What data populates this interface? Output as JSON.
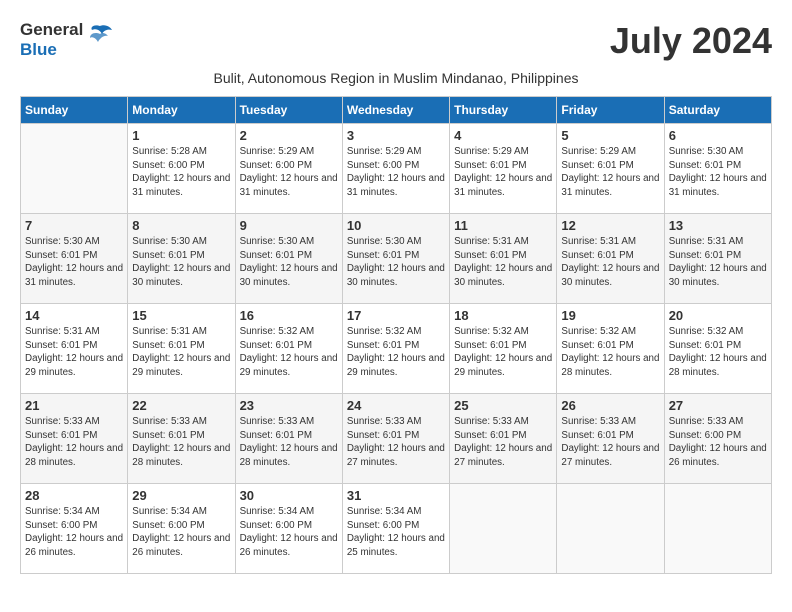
{
  "header": {
    "logo_general": "General",
    "logo_blue": "Blue",
    "month_title": "July 2024",
    "subtitle": "Bulit, Autonomous Region in Muslim Mindanao, Philippines"
  },
  "days_of_week": [
    "Sunday",
    "Monday",
    "Tuesday",
    "Wednesday",
    "Thursday",
    "Friday",
    "Saturday"
  ],
  "weeks": [
    {
      "id": "week1",
      "days": [
        {
          "date": "",
          "sunrise": "",
          "sunset": "",
          "daylight": ""
        },
        {
          "date": "1",
          "sunrise": "Sunrise: 5:28 AM",
          "sunset": "Sunset: 6:00 PM",
          "daylight": "Daylight: 12 hours and 31 minutes."
        },
        {
          "date": "2",
          "sunrise": "Sunrise: 5:29 AM",
          "sunset": "Sunset: 6:00 PM",
          "daylight": "Daylight: 12 hours and 31 minutes."
        },
        {
          "date": "3",
          "sunrise": "Sunrise: 5:29 AM",
          "sunset": "Sunset: 6:00 PM",
          "daylight": "Daylight: 12 hours and 31 minutes."
        },
        {
          "date": "4",
          "sunrise": "Sunrise: 5:29 AM",
          "sunset": "Sunset: 6:01 PM",
          "daylight": "Daylight: 12 hours and 31 minutes."
        },
        {
          "date": "5",
          "sunrise": "Sunrise: 5:29 AM",
          "sunset": "Sunset: 6:01 PM",
          "daylight": "Daylight: 12 hours and 31 minutes."
        },
        {
          "date": "6",
          "sunrise": "Sunrise: 5:30 AM",
          "sunset": "Sunset: 6:01 PM",
          "daylight": "Daylight: 12 hours and 31 minutes."
        }
      ]
    },
    {
      "id": "week2",
      "days": [
        {
          "date": "7",
          "sunrise": "Sunrise: 5:30 AM",
          "sunset": "Sunset: 6:01 PM",
          "daylight": "Daylight: 12 hours and 31 minutes."
        },
        {
          "date": "8",
          "sunrise": "Sunrise: 5:30 AM",
          "sunset": "Sunset: 6:01 PM",
          "daylight": "Daylight: 12 hours and 30 minutes."
        },
        {
          "date": "9",
          "sunrise": "Sunrise: 5:30 AM",
          "sunset": "Sunset: 6:01 PM",
          "daylight": "Daylight: 12 hours and 30 minutes."
        },
        {
          "date": "10",
          "sunrise": "Sunrise: 5:30 AM",
          "sunset": "Sunset: 6:01 PM",
          "daylight": "Daylight: 12 hours and 30 minutes."
        },
        {
          "date": "11",
          "sunrise": "Sunrise: 5:31 AM",
          "sunset": "Sunset: 6:01 PM",
          "daylight": "Daylight: 12 hours and 30 minutes."
        },
        {
          "date": "12",
          "sunrise": "Sunrise: 5:31 AM",
          "sunset": "Sunset: 6:01 PM",
          "daylight": "Daylight: 12 hours and 30 minutes."
        },
        {
          "date": "13",
          "sunrise": "Sunrise: 5:31 AM",
          "sunset": "Sunset: 6:01 PM",
          "daylight": "Daylight: 12 hours and 30 minutes."
        }
      ]
    },
    {
      "id": "week3",
      "days": [
        {
          "date": "14",
          "sunrise": "Sunrise: 5:31 AM",
          "sunset": "Sunset: 6:01 PM",
          "daylight": "Daylight: 12 hours and 29 minutes."
        },
        {
          "date": "15",
          "sunrise": "Sunrise: 5:31 AM",
          "sunset": "Sunset: 6:01 PM",
          "daylight": "Daylight: 12 hours and 29 minutes."
        },
        {
          "date": "16",
          "sunrise": "Sunrise: 5:32 AM",
          "sunset": "Sunset: 6:01 PM",
          "daylight": "Daylight: 12 hours and 29 minutes."
        },
        {
          "date": "17",
          "sunrise": "Sunrise: 5:32 AM",
          "sunset": "Sunset: 6:01 PM",
          "daylight": "Daylight: 12 hours and 29 minutes."
        },
        {
          "date": "18",
          "sunrise": "Sunrise: 5:32 AM",
          "sunset": "Sunset: 6:01 PM",
          "daylight": "Daylight: 12 hours and 29 minutes."
        },
        {
          "date": "19",
          "sunrise": "Sunrise: 5:32 AM",
          "sunset": "Sunset: 6:01 PM",
          "daylight": "Daylight: 12 hours and 28 minutes."
        },
        {
          "date": "20",
          "sunrise": "Sunrise: 5:32 AM",
          "sunset": "Sunset: 6:01 PM",
          "daylight": "Daylight: 12 hours and 28 minutes."
        }
      ]
    },
    {
      "id": "week4",
      "days": [
        {
          "date": "21",
          "sunrise": "Sunrise: 5:33 AM",
          "sunset": "Sunset: 6:01 PM",
          "daylight": "Daylight: 12 hours and 28 minutes."
        },
        {
          "date": "22",
          "sunrise": "Sunrise: 5:33 AM",
          "sunset": "Sunset: 6:01 PM",
          "daylight": "Daylight: 12 hours and 28 minutes."
        },
        {
          "date": "23",
          "sunrise": "Sunrise: 5:33 AM",
          "sunset": "Sunset: 6:01 PM",
          "daylight": "Daylight: 12 hours and 28 minutes."
        },
        {
          "date": "24",
          "sunrise": "Sunrise: 5:33 AM",
          "sunset": "Sunset: 6:01 PM",
          "daylight": "Daylight: 12 hours and 27 minutes."
        },
        {
          "date": "25",
          "sunrise": "Sunrise: 5:33 AM",
          "sunset": "Sunset: 6:01 PM",
          "daylight": "Daylight: 12 hours and 27 minutes."
        },
        {
          "date": "26",
          "sunrise": "Sunrise: 5:33 AM",
          "sunset": "Sunset: 6:01 PM",
          "daylight": "Daylight: 12 hours and 27 minutes."
        },
        {
          "date": "27",
          "sunrise": "Sunrise: 5:33 AM",
          "sunset": "Sunset: 6:00 PM",
          "daylight": "Daylight: 12 hours and 26 minutes."
        }
      ]
    },
    {
      "id": "week5",
      "days": [
        {
          "date": "28",
          "sunrise": "Sunrise: 5:34 AM",
          "sunset": "Sunset: 6:00 PM",
          "daylight": "Daylight: 12 hours and 26 minutes."
        },
        {
          "date": "29",
          "sunrise": "Sunrise: 5:34 AM",
          "sunset": "Sunset: 6:00 PM",
          "daylight": "Daylight: 12 hours and 26 minutes."
        },
        {
          "date": "30",
          "sunrise": "Sunrise: 5:34 AM",
          "sunset": "Sunset: 6:00 PM",
          "daylight": "Daylight: 12 hours and 26 minutes."
        },
        {
          "date": "31",
          "sunrise": "Sunrise: 5:34 AM",
          "sunset": "Sunset: 6:00 PM",
          "daylight": "Daylight: 12 hours and 25 minutes."
        },
        {
          "date": "",
          "sunrise": "",
          "sunset": "",
          "daylight": ""
        },
        {
          "date": "",
          "sunrise": "",
          "sunset": "",
          "daylight": ""
        },
        {
          "date": "",
          "sunrise": "",
          "sunset": "",
          "daylight": ""
        }
      ]
    }
  ]
}
